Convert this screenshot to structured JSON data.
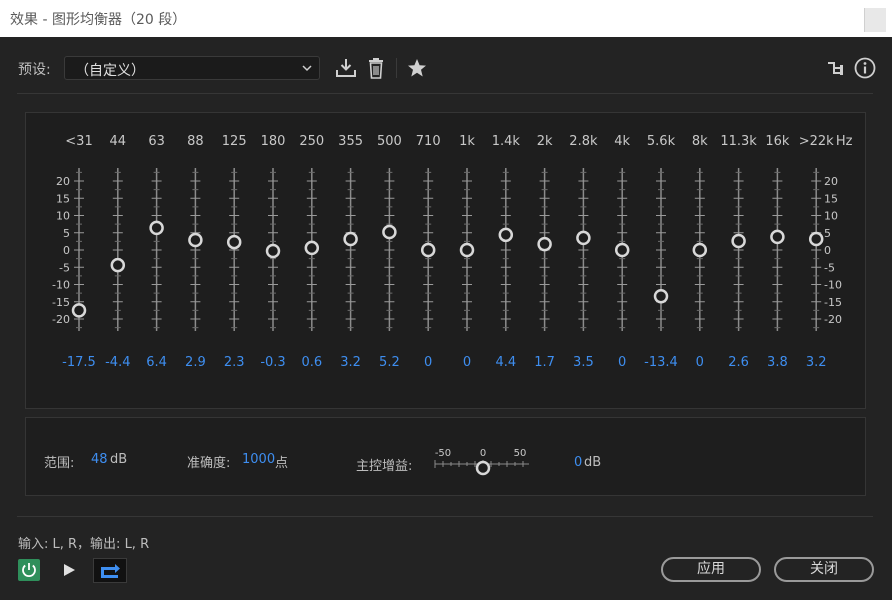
{
  "window": {
    "title": "效果 - 图形均衡器（20 段）"
  },
  "toolbar": {
    "preset_label": "预设:",
    "preset_value": "（自定义）",
    "icons": [
      "save-preset-icon",
      "delete-preset-icon",
      "favorite-star-icon",
      "routing-icon",
      "info-icon"
    ]
  },
  "eq": {
    "hz_label": "Hz",
    "scale_ticks": [
      "20",
      "15",
      "10",
      "5",
      "0",
      "-5",
      "-10",
      "-15",
      "-20"
    ],
    "bands": [
      {
        "freq": "<31",
        "gain": -17.5,
        "gain_text": "-17.5"
      },
      {
        "freq": "44",
        "gain": -4.4,
        "gain_text": "-4.4"
      },
      {
        "freq": "63",
        "gain": 6.4,
        "gain_text": "6.4"
      },
      {
        "freq": "88",
        "gain": 2.9,
        "gain_text": "2.9"
      },
      {
        "freq": "125",
        "gain": 2.3,
        "gain_text": "2.3"
      },
      {
        "freq": "180",
        "gain": -0.3,
        "gain_text": "-0.3"
      },
      {
        "freq": "250",
        "gain": 0.6,
        "gain_text": "0.6"
      },
      {
        "freq": "355",
        "gain": 3.2,
        "gain_text": "3.2"
      },
      {
        "freq": "500",
        "gain": 5.2,
        "gain_text": "5.2"
      },
      {
        "freq": "710",
        "gain": 0,
        "gain_text": "0"
      },
      {
        "freq": "1k",
        "gain": 0,
        "gain_text": "0"
      },
      {
        "freq": "1.4k",
        "gain": 4.4,
        "gain_text": "4.4"
      },
      {
        "freq": "2k",
        "gain": 1.7,
        "gain_text": "1.7"
      },
      {
        "freq": "2.8k",
        "gain": 3.5,
        "gain_text": "3.5"
      },
      {
        "freq": "4k",
        "gain": 0,
        "gain_text": "0"
      },
      {
        "freq": "5.6k",
        "gain": -13.4,
        "gain_text": "-13.4"
      },
      {
        "freq": "8k",
        "gain": 0,
        "gain_text": "0"
      },
      {
        "freq": "11.3k",
        "gain": 2.6,
        "gain_text": "2.6"
      },
      {
        "freq": "16k",
        "gain": 3.8,
        "gain_text": "3.8"
      },
      {
        "freq": ">22k",
        "gain": 3.2,
        "gain_text": "3.2"
      }
    ]
  },
  "settings": {
    "range_label": "范围:",
    "range_value": "48",
    "range_unit": "dB",
    "accuracy_label": "准确度:",
    "accuracy_value": "1000",
    "accuracy_unit": "点",
    "master_gain_label": "主控增益:",
    "master_gain_ticks": [
      "-50",
      "0",
      "50"
    ],
    "master_gain_value": "0",
    "master_gain_unit": "dB"
  },
  "footer": {
    "io_text": "输入: L, R，输出: L, R",
    "apply_label": "应用",
    "close_label": "关闭"
  },
  "colors": {
    "accent_blue": "#3e8ef0",
    "power_green": "#2f8f5b",
    "background": "#232323",
    "panel": "#1e1e1e"
  }
}
